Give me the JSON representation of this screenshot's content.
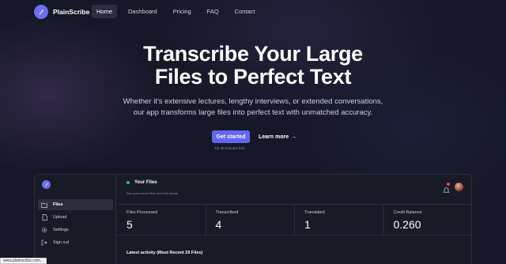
{
  "nav": {
    "brand": "PlainScribe",
    "links": [
      {
        "label": "Home",
        "active": true
      },
      {
        "label": "Dashboard"
      },
      {
        "label": "Pricing"
      },
      {
        "label": "FAQ"
      },
      {
        "label": "Contact"
      }
    ]
  },
  "hero": {
    "title_line1": "Transcribe Your Large",
    "title_line2": "Files to Perfect Text",
    "subtitle_line1": "Whether it's extensive lectures, lengthy interviews, or extended conversations,",
    "subtitle_line2": "our app transforms large files into perfect text with unmatched accuracy.",
    "cta_primary": "Get started",
    "cta_secondary": "Learn more",
    "cta_secondary_arrow": "→",
    "trial_note": "Try 30 minutes free"
  },
  "app": {
    "sidebar": {
      "items": [
        {
          "label": "Files",
          "icon": "folder-icon",
          "active": true
        },
        {
          "label": "Upload",
          "icon": "upload-icon"
        },
        {
          "label": "Settings",
          "icon": "gear-icon"
        },
        {
          "label": "Sign out",
          "icon": "signout-icon"
        }
      ]
    },
    "header": {
      "title": "Your Files",
      "subtitle": "See your recent files and their status"
    },
    "stats": [
      {
        "label": "Files Processed",
        "value": "5"
      },
      {
        "label": "Transcribed",
        "value": "4"
      },
      {
        "label": "Translated",
        "value": "1"
      },
      {
        "label": "Credit Balance",
        "value": "0.260"
      }
    ],
    "activity_title": "Latest activity (Most Recent 20 Files)"
  },
  "status_url": "www.plainscribe.com...",
  "colors": {
    "accent": "#6366f1",
    "background": "#161827",
    "status_green": "#22c55e",
    "badge_red": "#ef4444"
  }
}
